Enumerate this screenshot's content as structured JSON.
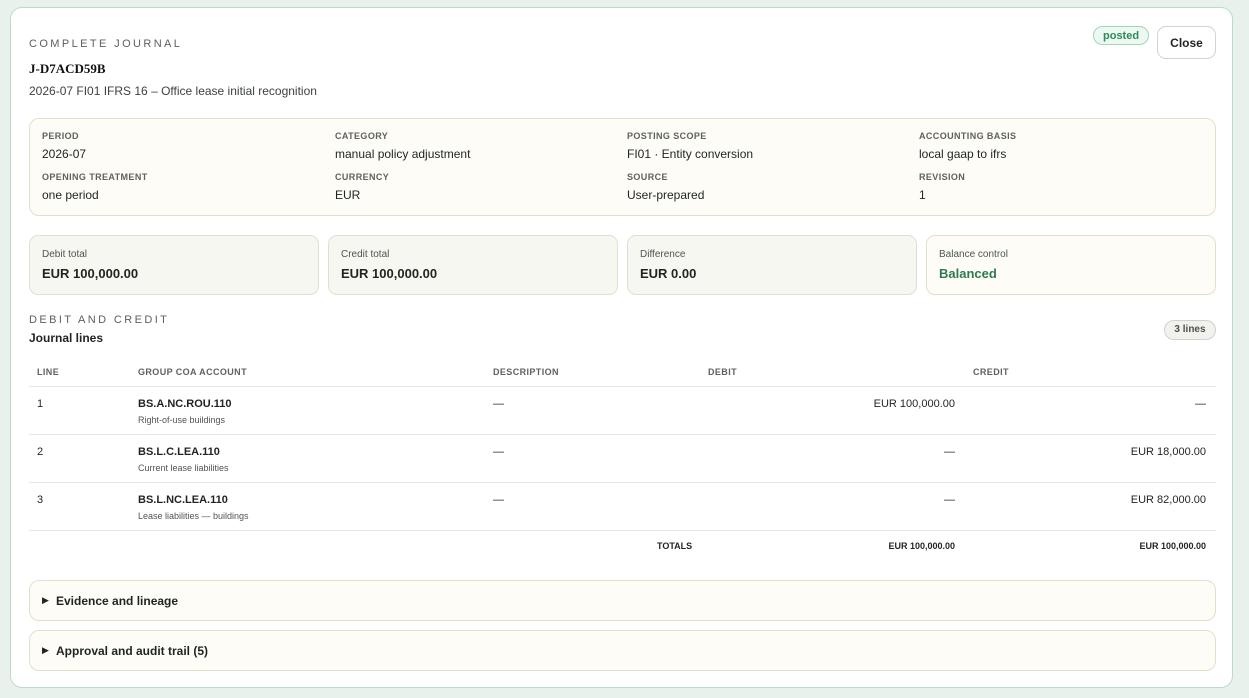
{
  "header": {
    "eyebrow": "Complete journal",
    "journal_id": "J-D7ACD59B",
    "subtitle": "2026-07 FI01 IFRS 16 – Office lease initial recognition",
    "status_badge": "posted",
    "close_label": "Close"
  },
  "meta": [
    {
      "label": "Period",
      "value": "2026-07"
    },
    {
      "label": "Category",
      "value": "manual policy adjustment"
    },
    {
      "label": "Posting scope",
      "value": "FI01 · Entity conversion"
    },
    {
      "label": "Accounting basis",
      "value": "local gaap to ifrs"
    },
    {
      "label": "Opening treatment",
      "value": "one period"
    },
    {
      "label": "Currency",
      "value": "EUR"
    },
    {
      "label": "Source",
      "value": "User-prepared"
    },
    {
      "label": "Revision",
      "value": "1"
    }
  ],
  "totals": [
    {
      "label": "Debit total",
      "value": "EUR 100,000.00"
    },
    {
      "label": "Credit total",
      "value": "EUR 100,000.00"
    },
    {
      "label": "Difference",
      "value": "EUR 0.00"
    },
    {
      "label": "Balance control",
      "value": "Balanced"
    }
  ],
  "lines_section": {
    "eyebrow": "Debit and credit",
    "title": "Journal lines",
    "count_badge": "3 lines",
    "columns": [
      "Line",
      "Group COA account",
      "Description",
      "Debit",
      "Credit"
    ],
    "rows": [
      {
        "line": "1",
        "account_code": "BS.A.NC.ROU.110",
        "account_name": "Right-of-use buildings",
        "description": "—",
        "debit": "EUR 100,000.00",
        "credit": "—"
      },
      {
        "line": "2",
        "account_code": "BS.L.C.LEA.110",
        "account_name": "Current lease liabilities",
        "description": "—",
        "debit": "—",
        "credit": "EUR 18,000.00"
      },
      {
        "line": "3",
        "account_code": "BS.L.NC.LEA.110",
        "account_name": "Lease liabilities — buildings",
        "description": "—",
        "debit": "—",
        "credit": "EUR 82,000.00"
      }
    ],
    "totals_label": "Totals",
    "totals_debit": "EUR 100,000.00",
    "totals_credit": "EUR 100,000.00"
  },
  "collapsibles": {
    "evidence": "Evidence and lineage",
    "approval": "Approval and audit trail (5)"
  },
  "colors": {
    "accent_green": "#2f8a58",
    "balanced_green": "#2f7a4e",
    "panel_cream": "#fdfcf7"
  }
}
